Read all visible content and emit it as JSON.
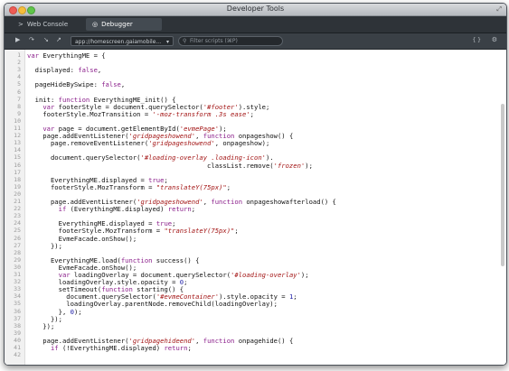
{
  "window": {
    "title": "Developer Tools"
  },
  "tabs": [
    {
      "label": "Web Console",
      "icon": ">"
    },
    {
      "label": "Debugger",
      "icon": "◎"
    }
  ],
  "toolbar": {
    "script_select": "app://homescreen.gaiamobile...",
    "filter_placeholder": "Filter scripts (⌘P)",
    "right_label": "{ }"
  },
  "code": {
    "lines": [
      {
        "n": "1",
        "segs": [
          {
            "t": "var ",
            "c": "kw"
          },
          {
            "t": "EverythingME = {"
          }
        ]
      },
      {
        "n": "2",
        "segs": []
      },
      {
        "n": "3",
        "segs": [
          {
            "t": "  displayed: "
          },
          {
            "t": "false",
            "c": "kw"
          },
          {
            "t": ","
          }
        ]
      },
      {
        "n": "4",
        "segs": []
      },
      {
        "n": "5",
        "segs": [
          {
            "t": "  pageHideBySwipe: "
          },
          {
            "t": "false",
            "c": "kw"
          },
          {
            "t": ","
          }
        ]
      },
      {
        "n": "6",
        "segs": []
      },
      {
        "n": "7",
        "segs": [
          {
            "t": "  init: "
          },
          {
            "t": "function",
            "c": "kw"
          },
          {
            "t": " EverythingME_init() {"
          }
        ]
      },
      {
        "n": "8",
        "segs": [
          {
            "t": "    "
          },
          {
            "t": "var",
            "c": "kw"
          },
          {
            "t": " footerStyle = document.querySelector("
          },
          {
            "t": "'#footer'",
            "c": "str"
          },
          {
            "t": ").style;"
          }
        ]
      },
      {
        "n": "9",
        "segs": [
          {
            "t": "    footerStyle.MozTransition = "
          },
          {
            "t": "'-moz-transform .3s ease'",
            "c": "str"
          },
          {
            "t": ";"
          }
        ]
      },
      {
        "n": "10",
        "segs": []
      },
      {
        "n": "11",
        "segs": [
          {
            "t": "    "
          },
          {
            "t": "var",
            "c": "kw"
          },
          {
            "t": " page = document.getElementById("
          },
          {
            "t": "'evmePage'",
            "c": "str"
          },
          {
            "t": ");"
          }
        ]
      },
      {
        "n": "12",
        "segs": [
          {
            "t": "    page.addEventListener("
          },
          {
            "t": "'gridpageshowend'",
            "c": "str"
          },
          {
            "t": ", "
          },
          {
            "t": "function",
            "c": "kw"
          },
          {
            "t": " onpageshow() {"
          }
        ]
      },
      {
        "n": "13",
        "segs": [
          {
            "t": "      page.removeEventListener("
          },
          {
            "t": "'gridpageshowend'",
            "c": "str"
          },
          {
            "t": ", onpageshow);"
          }
        ]
      },
      {
        "n": "14",
        "segs": []
      },
      {
        "n": "15",
        "segs": [
          {
            "t": "      document.querySelector("
          },
          {
            "t": "'#loading-overlay .loading-icon'",
            "c": "str"
          },
          {
            "t": ")."
          }
        ]
      },
      {
        "n": "16",
        "segs": [
          {
            "t": "                                              classList.remove("
          },
          {
            "t": "'frozen'",
            "c": "str"
          },
          {
            "t": ");"
          }
        ]
      },
      {
        "n": "17",
        "segs": []
      },
      {
        "n": "18",
        "segs": [
          {
            "t": "      EverythingME.displayed = "
          },
          {
            "t": "true",
            "c": "kw"
          },
          {
            "t": ";"
          }
        ]
      },
      {
        "n": "19",
        "segs": [
          {
            "t": "      footerStyle.MozTransform = "
          },
          {
            "t": "\"translateY(75px)\"",
            "c": "str"
          },
          {
            "t": ";"
          }
        ]
      },
      {
        "n": "20",
        "segs": []
      },
      {
        "n": "21",
        "segs": [
          {
            "t": "      page.addEventListener("
          },
          {
            "t": "'gridpageshowend'",
            "c": "str"
          },
          {
            "t": ", "
          },
          {
            "t": "function",
            "c": "kw"
          },
          {
            "t": " onpageshowafterload() {"
          }
        ]
      },
      {
        "n": "22",
        "segs": [
          {
            "t": "        "
          },
          {
            "t": "if",
            "c": "kw"
          },
          {
            "t": " (EverythingME.displayed) "
          },
          {
            "t": "return",
            "c": "kw"
          },
          {
            "t": ";"
          }
        ]
      },
      {
        "n": "23",
        "segs": []
      },
      {
        "n": "24",
        "segs": [
          {
            "t": "        EverythingME.displayed = "
          },
          {
            "t": "true",
            "c": "kw"
          },
          {
            "t": ";"
          }
        ]
      },
      {
        "n": "25",
        "segs": [
          {
            "t": "        footerStyle.MozTransform = "
          },
          {
            "t": "\"translateY(75px)\"",
            "c": "str"
          },
          {
            "t": ";"
          }
        ]
      },
      {
        "n": "26",
        "segs": [
          {
            "t": "        EvmeFacade.onShow();"
          }
        ]
      },
      {
        "n": "27",
        "segs": [
          {
            "t": "      });"
          }
        ]
      },
      {
        "n": "28",
        "segs": []
      },
      {
        "n": "29",
        "segs": [
          {
            "t": "      EverythingME.load("
          },
          {
            "t": "function",
            "c": "kw"
          },
          {
            "t": " success() {"
          }
        ]
      },
      {
        "n": "30",
        "segs": [
          {
            "t": "        EvmeFacade.onShow();"
          }
        ]
      },
      {
        "n": "31",
        "segs": [
          {
            "t": "        "
          },
          {
            "t": "var",
            "c": "kw"
          },
          {
            "t": " loadingOverlay = document.querySelector("
          },
          {
            "t": "'#loading-overlay'",
            "c": "str"
          },
          {
            "t": ");"
          }
        ]
      },
      {
        "n": "32",
        "segs": [
          {
            "t": "        loadingOverlay.style.opacity = "
          },
          {
            "t": "0",
            "c": "num"
          },
          {
            "t": ";"
          }
        ]
      },
      {
        "n": "33",
        "segs": [
          {
            "t": "        setTimeout("
          },
          {
            "t": "function",
            "c": "kw"
          },
          {
            "t": " starting() {"
          }
        ]
      },
      {
        "n": "34",
        "segs": [
          {
            "t": "          document.querySelector("
          },
          {
            "t": "'#evmeContainer'",
            "c": "str"
          },
          {
            "t": ").style.opacity = "
          },
          {
            "t": "1",
            "c": "num"
          },
          {
            "t": ";"
          }
        ]
      },
      {
        "n": "35",
        "segs": [
          {
            "t": "          loadingOverlay.parentNode.removeChild(loadingOverlay);"
          }
        ]
      },
      {
        "n": "36",
        "segs": [
          {
            "t": "        }, "
          },
          {
            "t": "0",
            "c": "num"
          },
          {
            "t": ");"
          }
        ]
      },
      {
        "n": "37",
        "segs": [
          {
            "t": "      });"
          }
        ]
      },
      {
        "n": "38",
        "segs": [
          {
            "t": "    });"
          }
        ]
      },
      {
        "n": "39",
        "segs": []
      },
      {
        "n": "40",
        "segs": [
          {
            "t": "    page.addEventListener("
          },
          {
            "t": "'gridpagehideend'",
            "c": "str"
          },
          {
            "t": ", "
          },
          {
            "t": "function",
            "c": "kw"
          },
          {
            "t": " onpagehide() {"
          }
        ]
      },
      {
        "n": "41",
        "segs": [
          {
            "t": "      "
          },
          {
            "t": "if",
            "c": "kw"
          },
          {
            "t": " (!EverythingME.displayed) "
          },
          {
            "t": "return",
            "c": "kw"
          },
          {
            "t": ";"
          }
        ]
      },
      {
        "n": "42",
        "segs": []
      }
    ]
  }
}
